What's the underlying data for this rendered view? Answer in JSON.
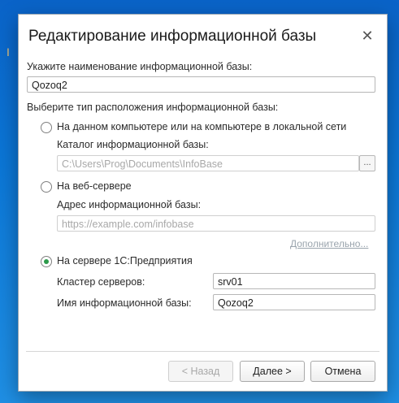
{
  "dialog": {
    "title": "Редактирование информационной базы",
    "close_glyph": "✕"
  },
  "name_section": {
    "label": "Укажите наименование информационной базы:",
    "value": "Qozoq2"
  },
  "location": {
    "label": "Выберите тип расположения информационной базы:",
    "local": {
      "label": "На данном компьютере или на компьютере в локальной сети",
      "catalog_label": "Каталог информационной базы:",
      "catalog_placeholder": "C:\\Users\\Prog\\Documents\\InfoBase",
      "browse_label": "..."
    },
    "web": {
      "label": "На веб-сервере",
      "address_label": "Адрес информационной базы:",
      "address_placeholder": "https://example.com/infobase",
      "more_link": "Дополнительно..."
    },
    "server": {
      "label": "На сервере 1С:Предприятия",
      "cluster_label": "Кластер серверов:",
      "cluster_value": "srv01",
      "ib_name_label": "Имя информационной базы:",
      "ib_name_value": "Qozoq2"
    },
    "selected": "server"
  },
  "buttons": {
    "back": "< Назад",
    "next": "Далее >",
    "cancel": "Отмена"
  },
  "colors": {
    "radio_selected": "#2c9a4a",
    "desktop": "#0b76d6"
  }
}
